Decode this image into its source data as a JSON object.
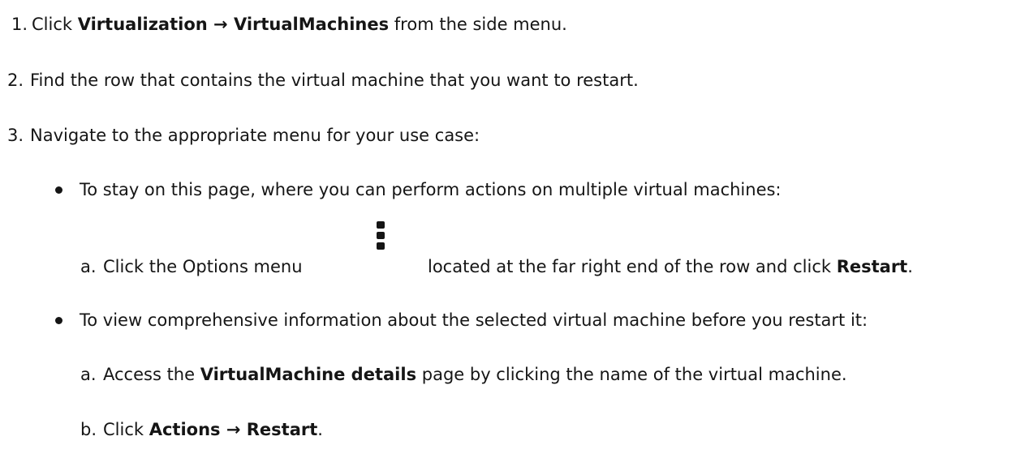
{
  "steps": [
    {
      "marker": "1.",
      "pre": "Click ",
      "b1": "Virtualization",
      "mid": " → ",
      "b2": "VirtualMachines",
      "post": " from the side menu."
    },
    {
      "marker": "2.",
      "text": "Find the row that contains the virtual machine that you want to restart."
    },
    {
      "marker": "3.",
      "text": "Navigate to the appropriate menu for your use case:"
    }
  ],
  "options": [
    {
      "bullet_text": "To stay on this page, where you can perform actions on multiple virtual machines:",
      "sub": {
        "marker": "a.",
        "pre": "Click the Options menu",
        "icon": "kebab-menu-icon",
        "post": "located at the far right end of the row and click ",
        "bold": "Restart",
        "end": "."
      }
    },
    {
      "bullet_text": "To view comprehensive information about the selected virtual machine before you restart it:",
      "subs": [
        {
          "marker": "a.",
          "pre": "Access the ",
          "bold": "VirtualMachine details",
          "post": " page by clicking the name of the virtual machine."
        },
        {
          "marker": "b.",
          "pre": "Click ",
          "b1": "Actions",
          "mid": " → ",
          "b2": "Restart",
          "end": "."
        }
      ]
    }
  ]
}
